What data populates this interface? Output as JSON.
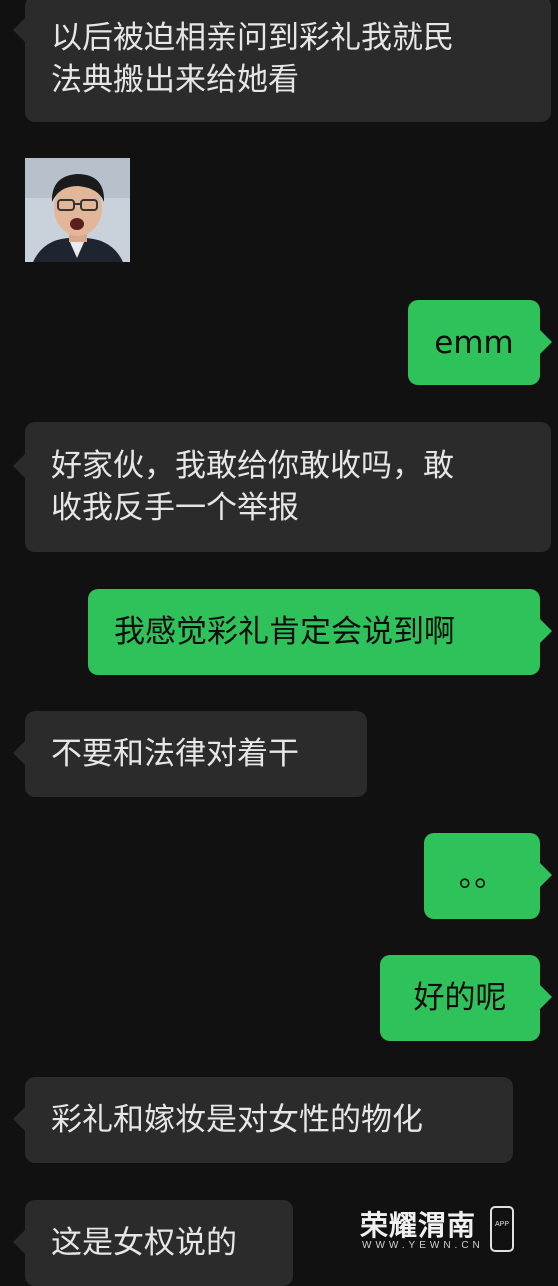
{
  "messages": [
    {
      "side": "in",
      "text_lines": [
        "以后被迫相亲问到彩礼我就民",
        "法典搬出来给她看"
      ]
    },
    {
      "side": "in",
      "type": "sticker",
      "sticker": "man-shouting-sticker"
    },
    {
      "side": "out",
      "text_lines": [
        "emm"
      ]
    },
    {
      "side": "in",
      "text_lines": [
        "好家伙，我敢给你敢收吗，敢",
        "收我反手一个举报"
      ]
    },
    {
      "side": "out",
      "text_lines": [
        "我感觉彩礼肯定会说到啊"
      ]
    },
    {
      "side": "in",
      "text_lines": [
        "不要和法律对着干"
      ]
    },
    {
      "side": "out",
      "text_lines": [
        "。。"
      ]
    },
    {
      "side": "out",
      "text_lines": [
        "好的呢"
      ]
    },
    {
      "side": "in",
      "text_lines": [
        "彩礼和嫁妆是对女性的物化"
      ]
    },
    {
      "side": "in",
      "text_lines": [
        "这是女权说的"
      ]
    }
  ],
  "watermark": {
    "title": "荣耀渭南",
    "subtitle": "WWW.YEWN.CN",
    "badge": "APP"
  },
  "colors": {
    "background": "#111111",
    "incoming_bubble": "#2b2b2b",
    "outgoing_bubble": "#2fc25b"
  }
}
